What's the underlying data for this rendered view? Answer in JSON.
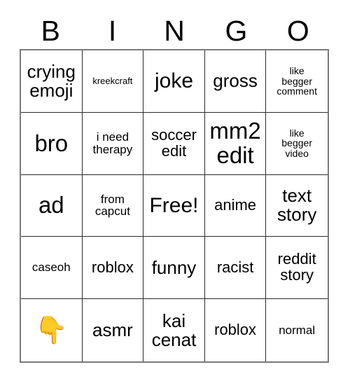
{
  "card": {
    "title_letters": [
      "B",
      "I",
      "N",
      "G",
      "O"
    ],
    "free_space_label": "Free!",
    "marker_icon": "pointing-down-finger-emoji",
    "marker_glyph": "👇",
    "marker_color": "#f5b察"
  },
  "colors": {
    "text": "#000000",
    "grid_border": "#2b2b2b",
    "outer_border": "#7a7a7a",
    "background": "#ffffff",
    "emoji_yellow": "#f5bb2e"
  },
  "grid": {
    "columns": 5,
    "rows": 5,
    "cells": [
      [
        {
          "text": "crying\nemoji",
          "size": "lg",
          "type": "text"
        },
        {
          "text": "kreekcraft",
          "size": "xxs",
          "type": "text"
        },
        {
          "text": "joke",
          "size": "xl",
          "type": "text"
        },
        {
          "text": "gross",
          "size": "lg",
          "type": "text"
        },
        {
          "text": "like\nbegger\ncomment",
          "size": "xs",
          "type": "text"
        }
      ],
      [
        {
          "text": "bro",
          "size": "xxl",
          "type": "text"
        },
        {
          "text": "i need\ntherapy",
          "size": "sm",
          "type": "text"
        },
        {
          "text": "soccer\nedit",
          "size": "md",
          "type": "text"
        },
        {
          "text": "mm2\nedit",
          "size": "xxl",
          "type": "text"
        },
        {
          "text": "like\nbegger\nvideo",
          "size": "xs",
          "type": "text"
        }
      ],
      [
        {
          "text": "ad",
          "size": "xxl",
          "type": "text"
        },
        {
          "text": "from\ncapcut",
          "size": "sm",
          "type": "text"
        },
        {
          "text": "Free!",
          "size": "xl",
          "type": "free"
        },
        {
          "text": "anime",
          "size": "md",
          "type": "text"
        },
        {
          "text": "text\nstory",
          "size": "lg",
          "type": "text"
        }
      ],
      [
        {
          "text": "caseoh",
          "size": "sm",
          "type": "text"
        },
        {
          "text": "roblox",
          "size": "md",
          "type": "text"
        },
        {
          "text": "funny",
          "size": "lg",
          "type": "text"
        },
        {
          "text": "racist",
          "size": "md",
          "type": "text"
        },
        {
          "text": "reddit\nstory",
          "size": "md",
          "type": "text"
        }
      ],
      [
        {
          "text": "👇",
          "size": "lg",
          "type": "emoji"
        },
        {
          "text": "asmr",
          "size": "lg",
          "type": "text"
        },
        {
          "text": "kai\ncenat",
          "size": "lg",
          "type": "text"
        },
        {
          "text": "roblox",
          "size": "md",
          "type": "text"
        },
        {
          "text": "normal",
          "size": "sm",
          "type": "text"
        }
      ]
    ]
  }
}
